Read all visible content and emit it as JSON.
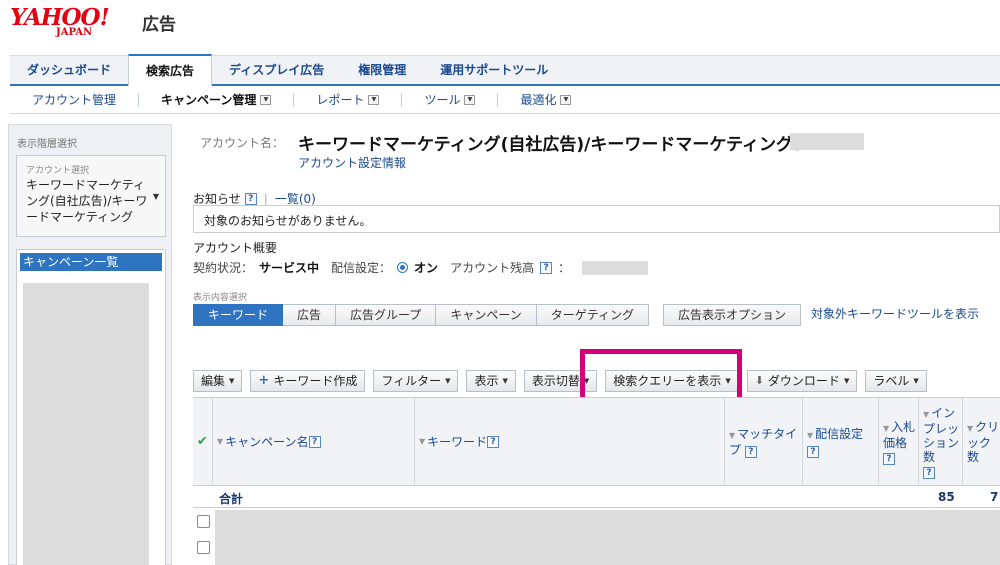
{
  "logo": {
    "yahoo": "YAHOO!",
    "japan": "JAPAN",
    "suffix": "広告"
  },
  "top_tabs": [
    "ダッシュボード",
    "検索広告",
    "ディスプレイ広告",
    "権限管理",
    "運用サポートツール"
  ],
  "sub_nav": [
    "アカウント管理",
    "キャンペーン管理",
    "レポート",
    "ツール",
    "最適化"
  ],
  "sidebar": {
    "label": "表示階層選択",
    "select_label": "アカウント選択",
    "select_text": "キーワードマーケティング(自社広告)/キーワードマーケティング",
    "list_item": "キャンペーン一覧"
  },
  "account": {
    "label": "アカウント名：",
    "name": "キーワードマーケティング(自社広告)/キーワードマーケティング：",
    "settings_link": "アカウント設定情報"
  },
  "notice": {
    "label": "お知らせ",
    "help": "?",
    "list_link": "一覧(0)",
    "message": "対象のお知らせがありません。"
  },
  "overview": {
    "title": "アカウント概要",
    "contract_label": "契約状況：",
    "contract_value": "サービス中",
    "delivery_label": "配信設定：",
    "delivery_value": "オン",
    "balance_label": "アカウント残高",
    "balance_suffix": "："
  },
  "content_select": {
    "label": "表示内容選択",
    "tabs": [
      "キーワード",
      "広告",
      "広告グループ",
      "キャンペーン",
      "ターゲティング"
    ],
    "option_tab": "広告表示オプション",
    "link": "対象外キーワードツールを表示"
  },
  "toolbar": {
    "edit": "編集",
    "create_keyword": "キーワード作成",
    "filter": "フィルター",
    "display": "表示",
    "switch": "表示切替",
    "search_query": "検索クエリーを表示",
    "download": "ダウンロード",
    "label": "ラベル"
  },
  "table": {
    "columns": {
      "campaign": "キャンペーン名",
      "keyword": "キーワード",
      "match_type": "マッチタイプ",
      "delivery": "配信設定",
      "bid": "入札価格",
      "impressions": "インプレッション数",
      "clicks": "クリック数"
    },
    "total_label": "合計",
    "total_impressions": "85",
    "total_clicks": "7"
  }
}
